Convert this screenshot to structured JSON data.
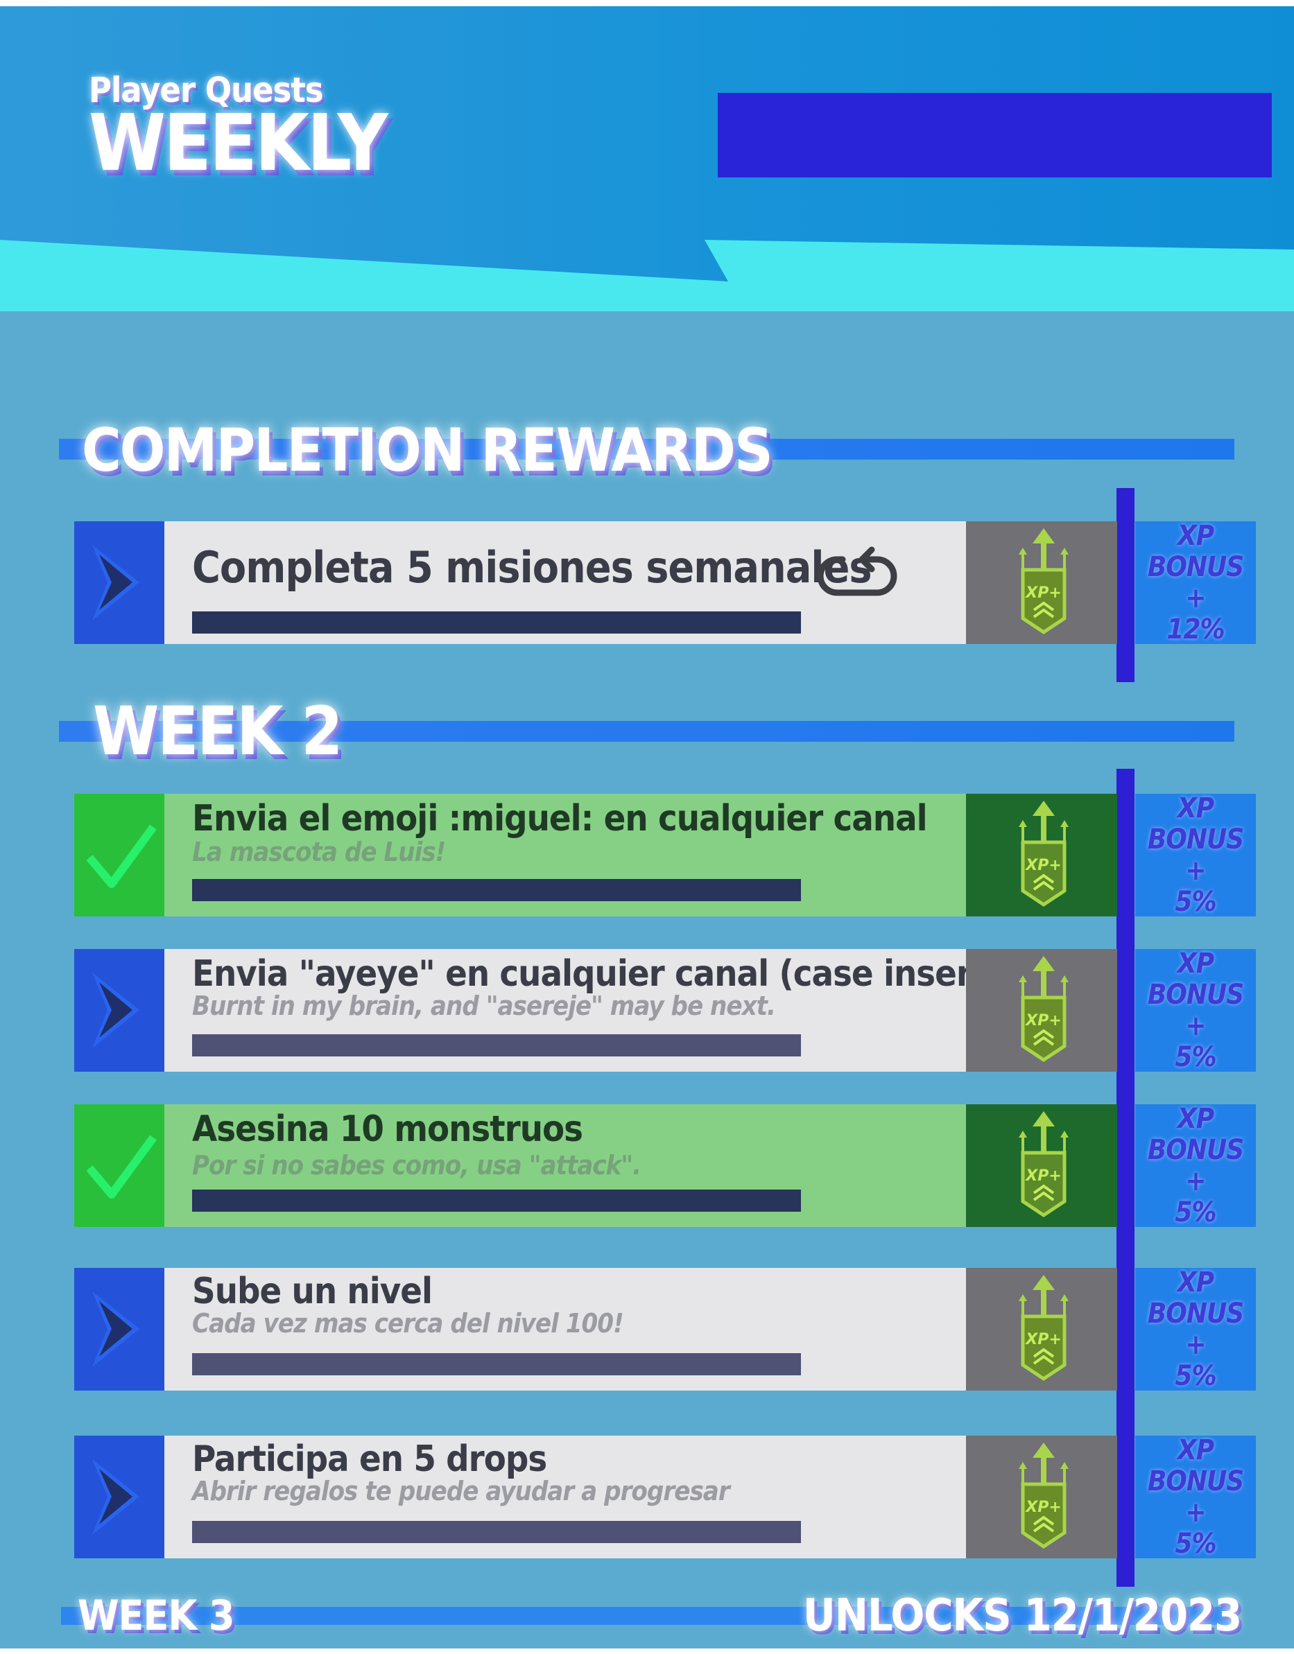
{
  "header": {
    "supertitle": "Player Quests",
    "title": "WEEKLY"
  },
  "completion": {
    "heading": "COMPLETION REWARDS",
    "quest": {
      "title": "Completa 5 misiones semanales",
      "reward_icon": "xp-plus-icon",
      "bonus": [
        "XP",
        "BONUS +",
        "12%"
      ],
      "progress": 0
    }
  },
  "week2": {
    "heading": "WEEK 2",
    "quests": [
      {
        "title": "Envia el emoji :miguel: en cualquier canal",
        "subtitle": "La mascota de Luis!",
        "completed": true,
        "progress": 1,
        "bonus": [
          "XP",
          "BONUS +",
          "5%"
        ]
      },
      {
        "title": "Envia \"ayeye\" en cualquier canal (case insensitive)",
        "subtitle": "Burnt in my brain, and \"asereje\" may be next.",
        "completed": false,
        "progress": 0,
        "bonus": [
          "XP",
          "BONUS +",
          "5%"
        ]
      },
      {
        "title": "Asesina 10 monstruos",
        "subtitle": "Por si no sabes como, usa \"attack\".",
        "completed": true,
        "progress": 1,
        "bonus": [
          "XP",
          "BONUS +",
          "5%"
        ]
      },
      {
        "title": "Sube un nivel",
        "subtitle": "Cada vez mas cerca del nivel 100!",
        "completed": false,
        "progress": 0,
        "bonus": [
          "XP",
          "BONUS +",
          "5%"
        ]
      },
      {
        "title": "Participa en 5 drops",
        "subtitle": "Abrir regalos te puede ayudar a progresar",
        "completed": false,
        "progress": 0,
        "bonus": [
          "XP",
          "BONUS +",
          "5%"
        ]
      }
    ]
  },
  "footer": {
    "next_week": "WEEK 3",
    "unlocks": "UNLOCKS 12/1/2023"
  },
  "colors": {
    "background": "#5babd0",
    "accent_blue": "#2453d9",
    "completed_green": "#86d086",
    "check_green": "#29bf3b",
    "bonus_box": "#2280e9",
    "divider": "#2d1fd3"
  }
}
